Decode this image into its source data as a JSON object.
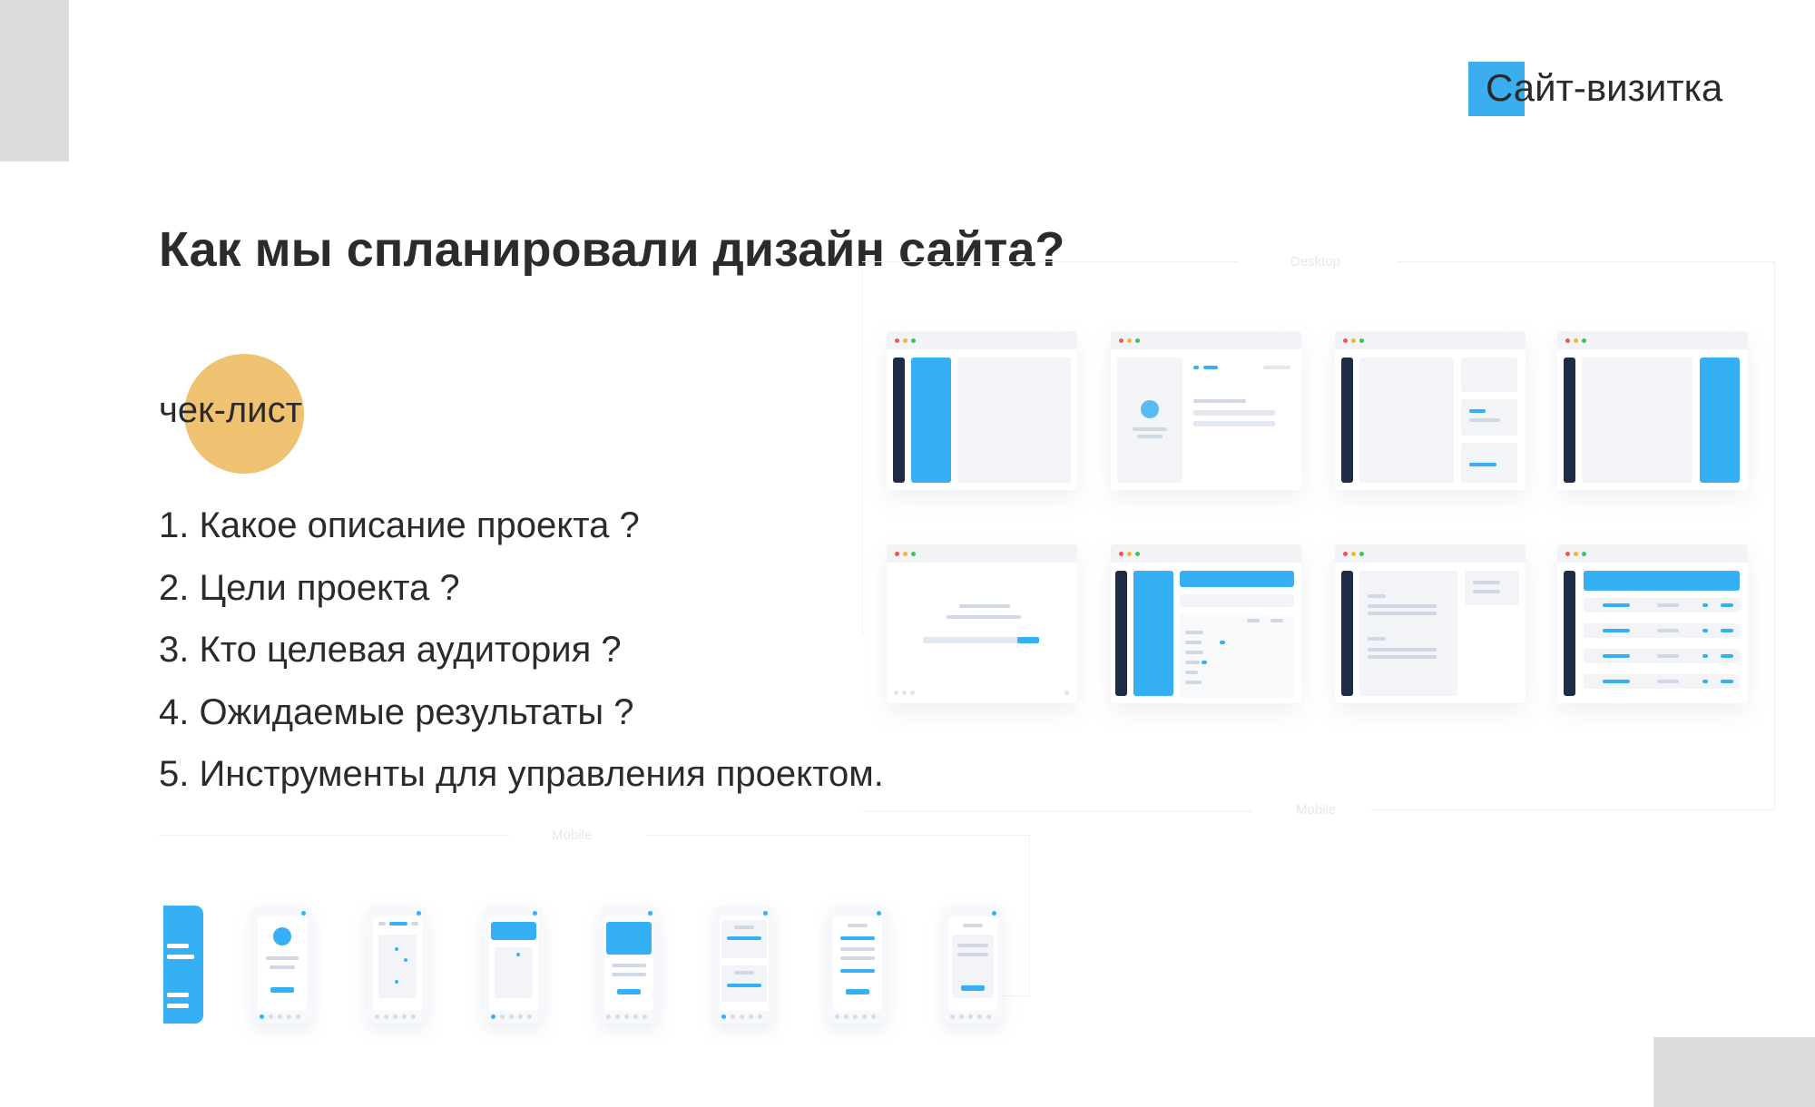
{
  "header": {
    "brand_label": "Сайт-визитка",
    "accent_color": "#3aaeee"
  },
  "title": "Как мы спланировали дизайн сайта?",
  "checklist": {
    "label": "чек-лист",
    "marker_color": "#efc271",
    "items": [
      "1. Какое описание проекта ?",
      "2. Цели проекта ?",
      "3. Кто целевая аудитория ?",
      "4. Ожидаемые результаты ?",
      "5. Инструменты для управления проектом."
    ]
  },
  "desktop_mockups": {
    "caption": "Desktop",
    "count": 8
  },
  "mobile_mockups": {
    "caption": "Mobile",
    "count": 8
  },
  "colors": {
    "text": "#2b2b2b",
    "wire_blue": "#35b0f5",
    "wire_dark": "#1f2c45",
    "corner_gray": "#dcdcdc"
  }
}
